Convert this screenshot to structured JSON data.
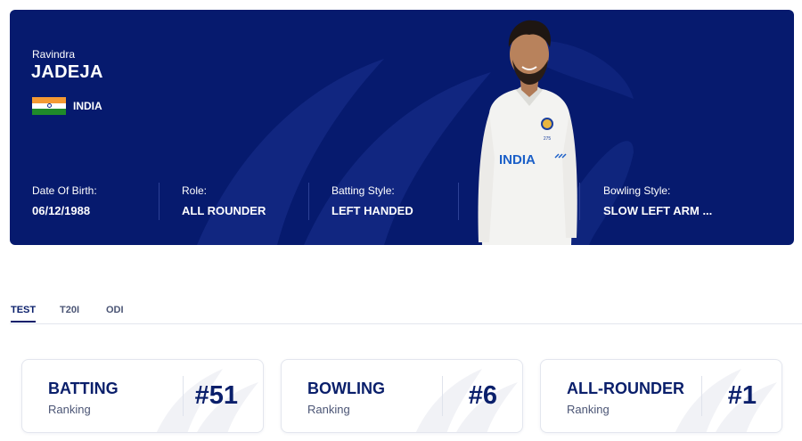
{
  "player": {
    "first_name": "Ravindra",
    "last_name": "JADEJA",
    "country": "INDIA",
    "stats": [
      {
        "label": "Date Of Birth:",
        "value": "06/12/1988"
      },
      {
        "label": "Role:",
        "value": "ALL ROUNDER"
      },
      {
        "label": "Batting Style:",
        "value": "LEFT HANDED"
      },
      {
        "label": "Bowling Style:",
        "value": "SLOW LEFT ARM ..."
      }
    ],
    "jersey_text": "INDIA",
    "jersey_number": "275"
  },
  "tabs": [
    {
      "label": "TEST",
      "active": true
    },
    {
      "label": "T20I",
      "active": false
    },
    {
      "label": "ODI",
      "active": false
    }
  ],
  "rankings": [
    {
      "title": "BATTING",
      "subtitle": "Ranking",
      "rank": "#51"
    },
    {
      "title": "BOWLING",
      "subtitle": "Ranking",
      "rank": "#6"
    },
    {
      "title": "ALL-ROUNDER",
      "subtitle": "Ranking",
      "rank": "#1"
    }
  ],
  "colors": {
    "hero_bg": "#061a6e",
    "text_primary": "#0a1f6b",
    "flag_saffron": "#f49a33",
    "flag_green": "#1f8a2a"
  }
}
